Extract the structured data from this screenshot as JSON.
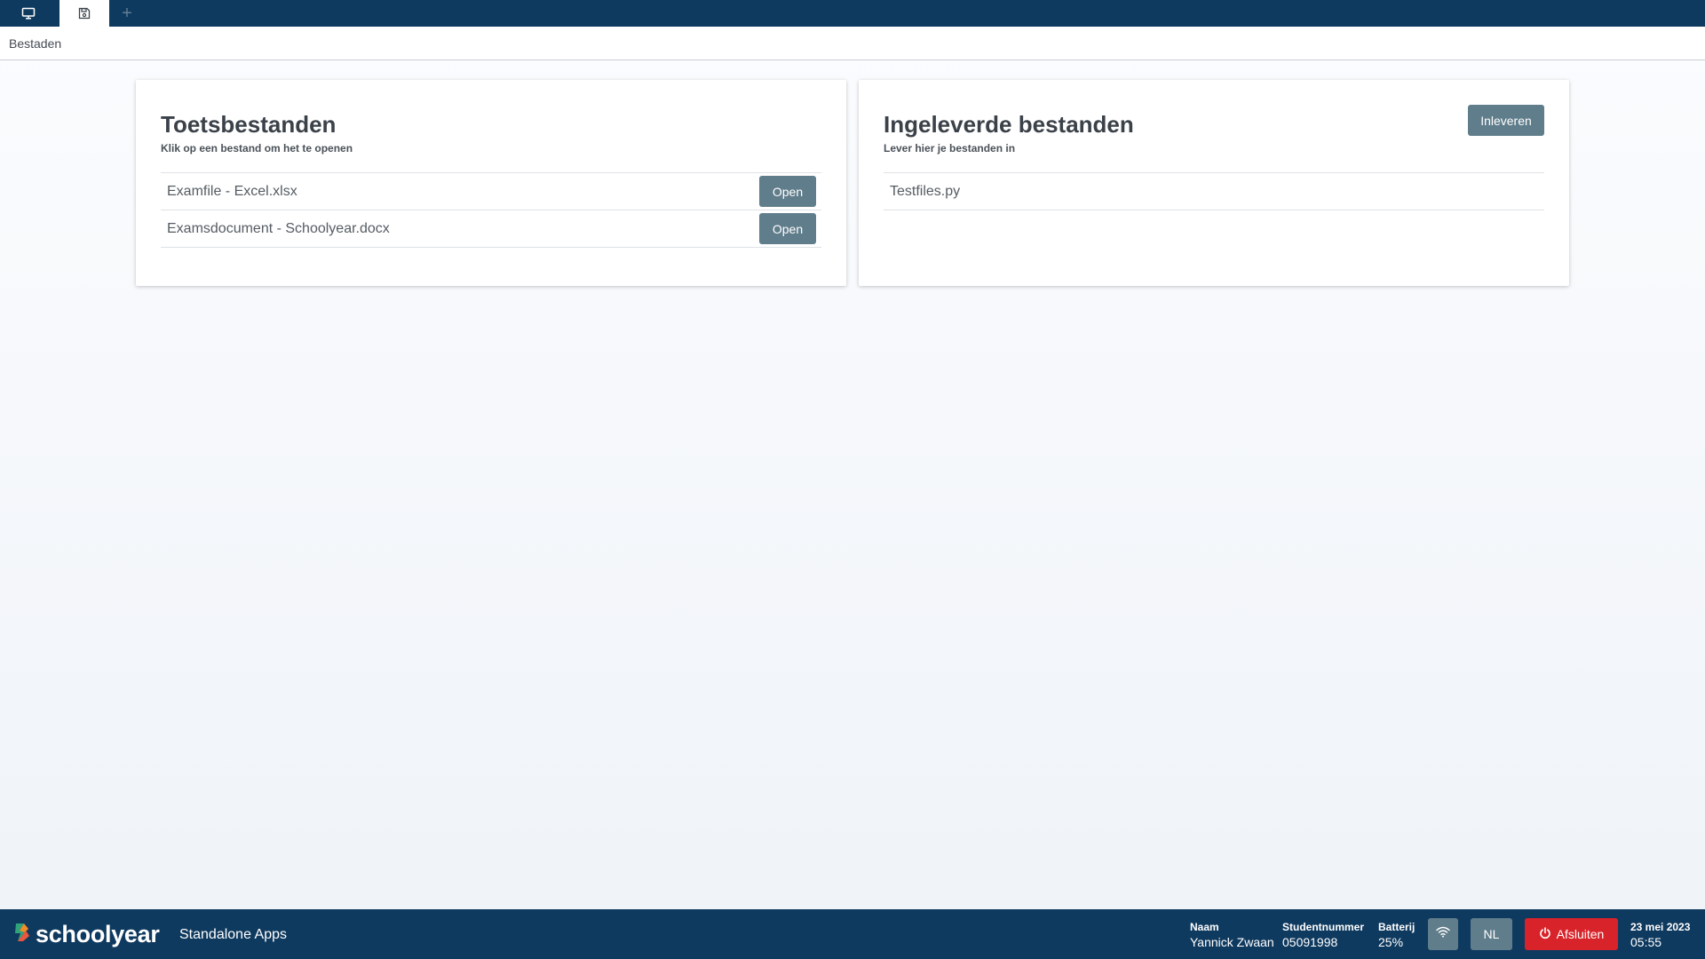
{
  "tabs": {
    "items": [
      {
        "icon": "monitor-icon",
        "active": false
      },
      {
        "icon": "save-icon",
        "active": true
      }
    ],
    "add_label": "+"
  },
  "breadcrumb": "Bestaden",
  "test_files": {
    "title": "Toetsbestanden",
    "subtitle": "Klik op een bestand om het te openen",
    "files": [
      {
        "name": "Examfile - Excel.xlsx",
        "action": "Open"
      },
      {
        "name": "Examsdocument - Schoolyear.docx",
        "action": "Open"
      }
    ]
  },
  "submitted_files": {
    "title": "Ingeleverde bestanden",
    "subtitle": "Lever hier je bestanden in",
    "submit_label": "Inleveren",
    "files": [
      {
        "name": "Testfiles.py"
      }
    ]
  },
  "footer": {
    "logo_text": "schoolyear",
    "app_label": "Standalone Apps",
    "name_label": "Naam",
    "name_value": "Yannick Zwaan",
    "student_label": "Studentnummer",
    "student_value": "05091998",
    "battery_label": "Batterij",
    "battery_value": "25%",
    "wifi_icon": "wifi-icon",
    "language": "NL",
    "exit_label": "Afsluiten",
    "date": "23 mei 2023",
    "time": "05:55"
  },
  "colors": {
    "navy": "#0f3a5f",
    "button_gray": "#607d8b",
    "exit_red": "#d8232a",
    "logo_green": "#2fa37a",
    "logo_orange": "#f28c28"
  }
}
